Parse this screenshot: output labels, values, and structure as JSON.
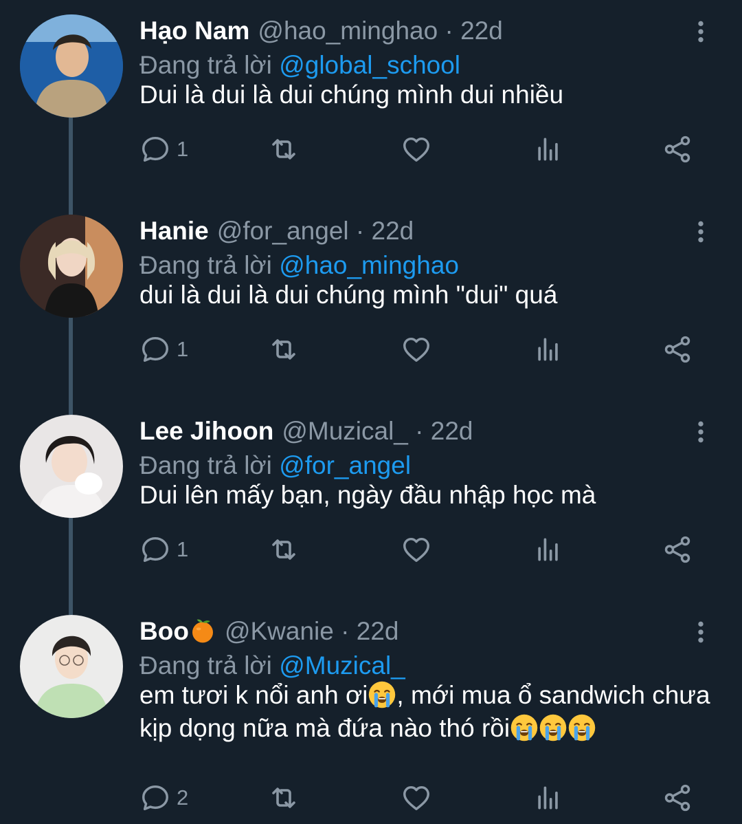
{
  "tweets": [
    {
      "name": "Hạo Nam",
      "handle": "@hao_minghao",
      "dot": "·",
      "time": "22d",
      "replying_prefix": "Đang trả lời",
      "replying_to": "@global_school",
      "text": "Dui là dui là dui chúng mình dui nhiều",
      "reply_count": "1"
    },
    {
      "name": "Hanie",
      "handle": "@for_angel",
      "dot": "·",
      "time": "22d",
      "replying_prefix": "Đang trả lời",
      "replying_to": "@hao_minghao",
      "text": "dui là dui là dui chúng mình \"dui\" quá",
      "reply_count": "1"
    },
    {
      "name": "Lee Jihoon",
      "handle": "@Muzical_",
      "dot": "·",
      "time": "22d",
      "replying_prefix": "Đang trả lời",
      "replying_to": "@for_angel",
      "text": "Dui lên mấy bạn, ngày đầu nhập học mà",
      "reply_count": "1"
    },
    {
      "name": "Boo",
      "name_emoji": "orange-emoji",
      "handle": "@Kwanie",
      "dot": "·",
      "time": "22d",
      "replying_prefix": "Đang trả lời",
      "replying_to": "@Muzical_",
      "text_part1": "em tươi k nổi anh ơi",
      "text_part2": ", mới mua ổ sandwich chưa kịp dọng nữa mà đứa nào thó rồi",
      "reply_count": "2"
    }
  ],
  "icons": {
    "reply": "reply-icon",
    "retweet": "retweet-icon",
    "like": "heart-icon",
    "views": "views-icon",
    "share": "share-icon",
    "more": "more-vertical-icon",
    "cry": "loudly-crying-face-emoji"
  },
  "colors": {
    "background": "#15202b",
    "text": "#ffffff",
    "secondary": "#8b98a5",
    "accent": "#1d9bf0",
    "thread_line": "#3d5466"
  }
}
